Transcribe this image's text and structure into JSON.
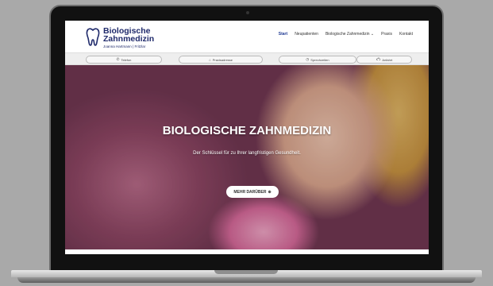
{
  "logo": {
    "title": "Biologische Zahnmedizin",
    "subtitle": "Joanna Hartmann | Fritzlar"
  },
  "nav": {
    "items": [
      {
        "label": "Start",
        "active": true
      },
      {
        "label": "Neupatienten",
        "active": false
      },
      {
        "label": "Biologische Zahnmedizin",
        "active": false,
        "dropdown": true
      },
      {
        "label": "Praxis",
        "active": false
      },
      {
        "label": "Kontakt",
        "active": false
      }
    ]
  },
  "quickbar": {
    "items": [
      {
        "label": "Telefon",
        "icon": "phone-icon"
      },
      {
        "label": "Praxisadresse",
        "icon": "home-icon"
      },
      {
        "label": "Sprechzeiten",
        "icon": "clock-icon"
      },
      {
        "label": "Anfahrt",
        "icon": "car-icon"
      }
    ]
  },
  "hero": {
    "title": "BIOLOGISCHE ZAHNMEDIZIN",
    "subtitle": "Der Schlüssel für zu Ihrer langfristigen Gesundheit.",
    "button_label": "MEHR DARÜBER",
    "slide_count": 8
  },
  "colors": {
    "brand": "#1f2a6b",
    "nav_active": "#1f3a93"
  }
}
